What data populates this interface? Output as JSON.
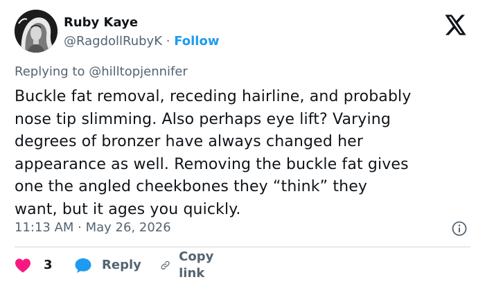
{
  "author": {
    "display_name": "Ruby Kaye",
    "handle": "@RagdollRubyK",
    "separator": "·",
    "follow_label": "Follow"
  },
  "reply_context": {
    "prefix": "Replying to",
    "target_handle": "@hilltopjennifer"
  },
  "tweet": {
    "lines": [
      "Buckle fat removal, receding hairline, and probably",
      "nose tip slimming. Also perhaps eye lift? Varying",
      "degrees of bronzer have always changed her",
      "appearance as well. Removing the buckle fat gives",
      "one the angled cheekbones they “think” they",
      "want, but it ages you quickly."
    ],
    "timestamp": "11:13 AM · May 26, 2026"
  },
  "actions": {
    "like_count": "3",
    "reply_label": "Reply",
    "copy_label": "Copy link"
  },
  "colors": {
    "accent": "#1d9bf0",
    "like": "#f91880",
    "muted": "#536471",
    "text": "#0f1419",
    "divider": "#cfd9de"
  },
  "icons": {
    "logo": "x-logo-icon",
    "info": "info-icon",
    "like": "heart-icon",
    "reply": "speech-bubble-icon",
    "copy": "link-icon"
  }
}
